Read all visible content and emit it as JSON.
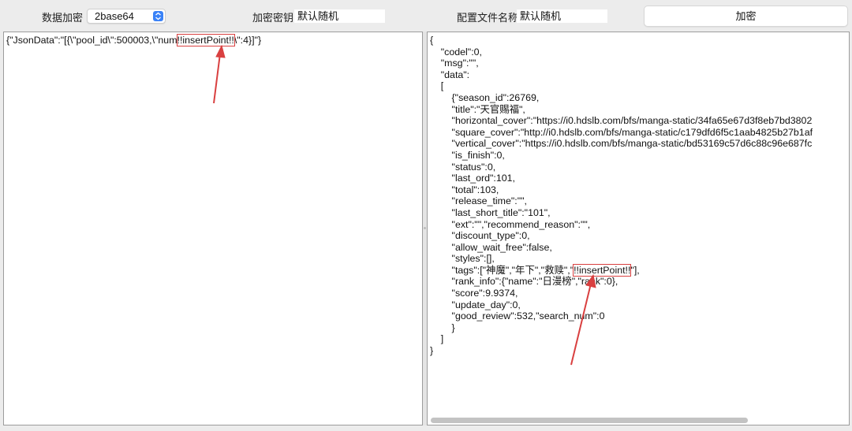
{
  "toolbar": {
    "encrypt_label": "数据加密",
    "encrypt_select": "2base64",
    "key_label": "加密密钥",
    "key_value": "默认随机",
    "config_label": "配置文件名称",
    "config_value": "默认随机",
    "encrypt_button": "加密"
  },
  "left_pane": {
    "before": "{\"JsonData\":\"[{\\\"pool_id\\\":500003,\\\"num",
    "highlight": "!!insertPoint!!",
    "after": "\\\":4}]\"}"
  },
  "right_pane": {
    "lines_before": [
      "{",
      "    \"codel\":0,",
      "    \"msg\":\"\",",
      "    \"data\":",
      "    [",
      "        {\"season_id\":26769,",
      "        \"title\":\"天官赐福\",",
      "        \"horizontal_cover\":\"https://i0.hdslb.com/bfs/manga-static/34fa65e67d3f8eb7bd3802",
      "        \"square_cover\":\"http://i0.hdslb.com/bfs/manga-static/c179dfd6f5c1aab4825b27b1af",
      "        \"vertical_cover\":\"https://i0.hdslb.com/bfs/manga-static/bd53169c57d6c88c96e687fc",
      "        \"is_finish\":0,",
      "        \"status\":0,",
      "        \"last_ord\":101,",
      "        \"total\":103,",
      "        \"release_time\":\"\",",
      "        \"last_short_title\":\"101\",",
      "        \"ext\":\"\",\"recommend_reason\":\"\",",
      "        \"discount_type\":0,",
      "        \"allow_wait_free\":false,",
      "        \"styles\":[],"
    ],
    "tags_prefix": "        \"tags\":[\"神魔\",\"年下\",\"救赎\",\"",
    "tags_highlight": "!!insertPoint!!",
    "tags_suffix": "\"],",
    "lines_after": [
      "        \"rank_info\":{\"name\":\"日漫榜\",\"rank\":0},",
      "        \"score\":9.9374,",
      "        \"update_day\":0,",
      "        \"good_review\":532,\"search_num\":0",
      "        }",
      "    ]",
      "}"
    ]
  },
  "colors": {
    "highlight": "#d94040",
    "accent": "#3a82f7"
  }
}
